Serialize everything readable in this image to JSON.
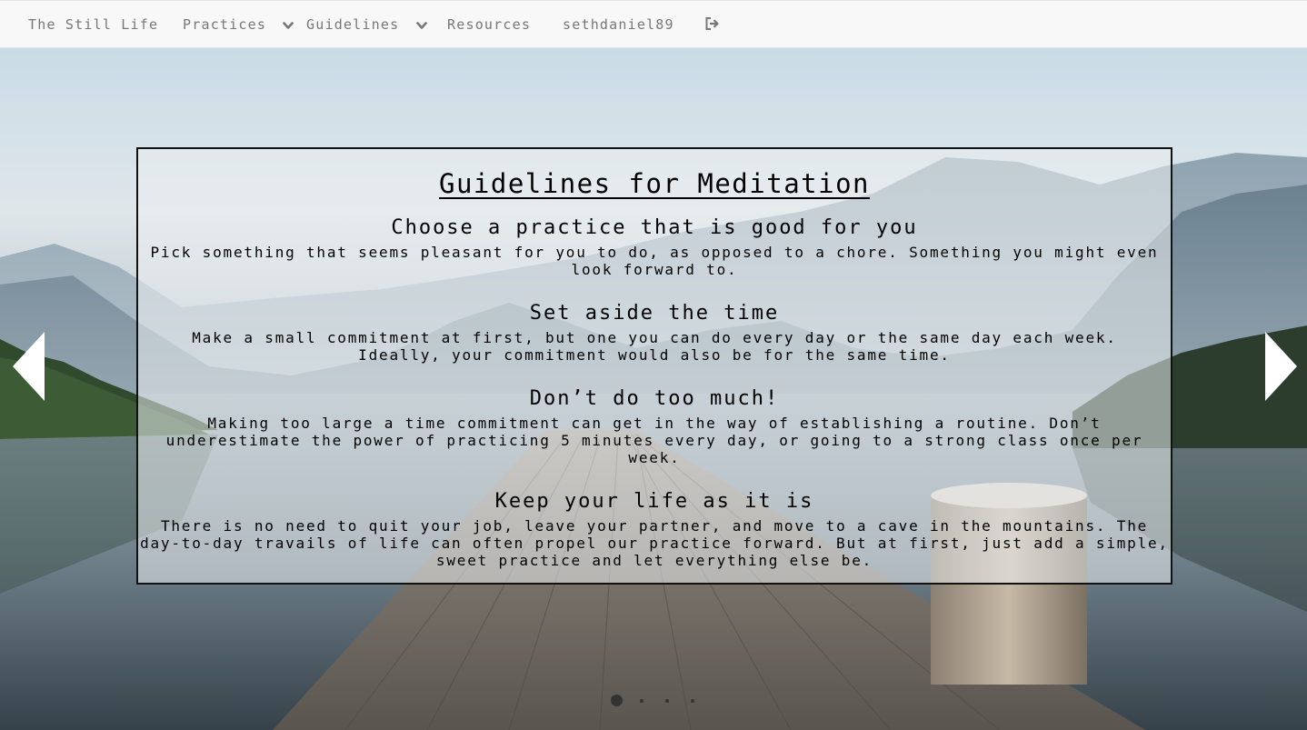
{
  "nav": {
    "brand": "The Still Life",
    "practices_label": "Practices",
    "guidelines_label": "Guidelines",
    "resources_label": "Resources",
    "username": "sethdaniel89",
    "logout_icon": "sign-out-icon",
    "dropdown_icon": "chevron-down-icon"
  },
  "slide": {
    "title": "Guidelines for Meditation",
    "sections": [
      {
        "heading": "Choose a practice that is good for you",
        "body": "Pick something that seems pleasant for you to do, as opposed to a chore. Something you might even look forward to."
      },
      {
        "heading": "Set aside the time",
        "body": "Make a small commitment at first, but one you can do every day or the same day each week. Ideally, your commitment would also be for the same time."
      },
      {
        "heading": "Don’t do too much!",
        "body": "Making too large a time commitment can get in the way of establishing a routine. Don’t underestimate the power of practicing 5 minutes every day, or going to a strong class once per week."
      },
      {
        "heading": "Keep your life as it is",
        "body": "There is no need to quit your job, leave your partner, and move to a cave in the mountains. The day-to-day travails of life can often propel our practice forward. But at first, just add a simple, sweet practice and let everything else be."
      }
    ]
  },
  "carousel": {
    "prev_icon": "chevron-left-icon",
    "next_icon": "chevron-right-icon",
    "slide_count": 4,
    "active_index": 0
  },
  "colors": {
    "navbar_bg": "#f8f8f8",
    "nav_text": "#777777",
    "panel_border": "#111111",
    "arrow": "#ffffff"
  }
}
